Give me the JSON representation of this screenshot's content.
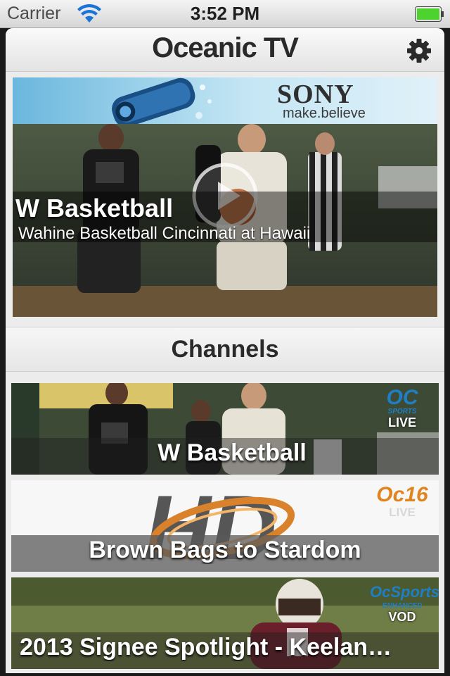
{
  "status_bar": {
    "carrier": "Carrier",
    "time": "3:52 PM"
  },
  "nav": {
    "title": "Oceanic TV",
    "settings_icon": "gear-icon"
  },
  "featured": {
    "ad": {
      "brand": "SONY",
      "tagline": "make.believe"
    },
    "title": "W Basketball",
    "subtitle": "Wahine Basketball Cincinnati at Hawaii",
    "play_icon": "play-icon"
  },
  "channels": {
    "header": "Channels",
    "items": [
      {
        "label": "W Basketball",
        "badge_logo": "OC",
        "badge_sub": "SPORTS",
        "badge_type": "LIVE"
      },
      {
        "label": "Brown Bags to Stardom",
        "badge_logo": "Oc16",
        "badge_sub": "",
        "badge_type": "LIVE",
        "art_text": "HD"
      },
      {
        "label": "2013 Signee Spotlight - Keelan…",
        "badge_logo": "OcSports",
        "badge_sub": "ENHANCED",
        "badge_type": "VOD"
      }
    ]
  },
  "colors": {
    "accent_blue": "#1f7fc4",
    "oc16_orange": "#e08420",
    "battery_green": "#4cd32e"
  }
}
